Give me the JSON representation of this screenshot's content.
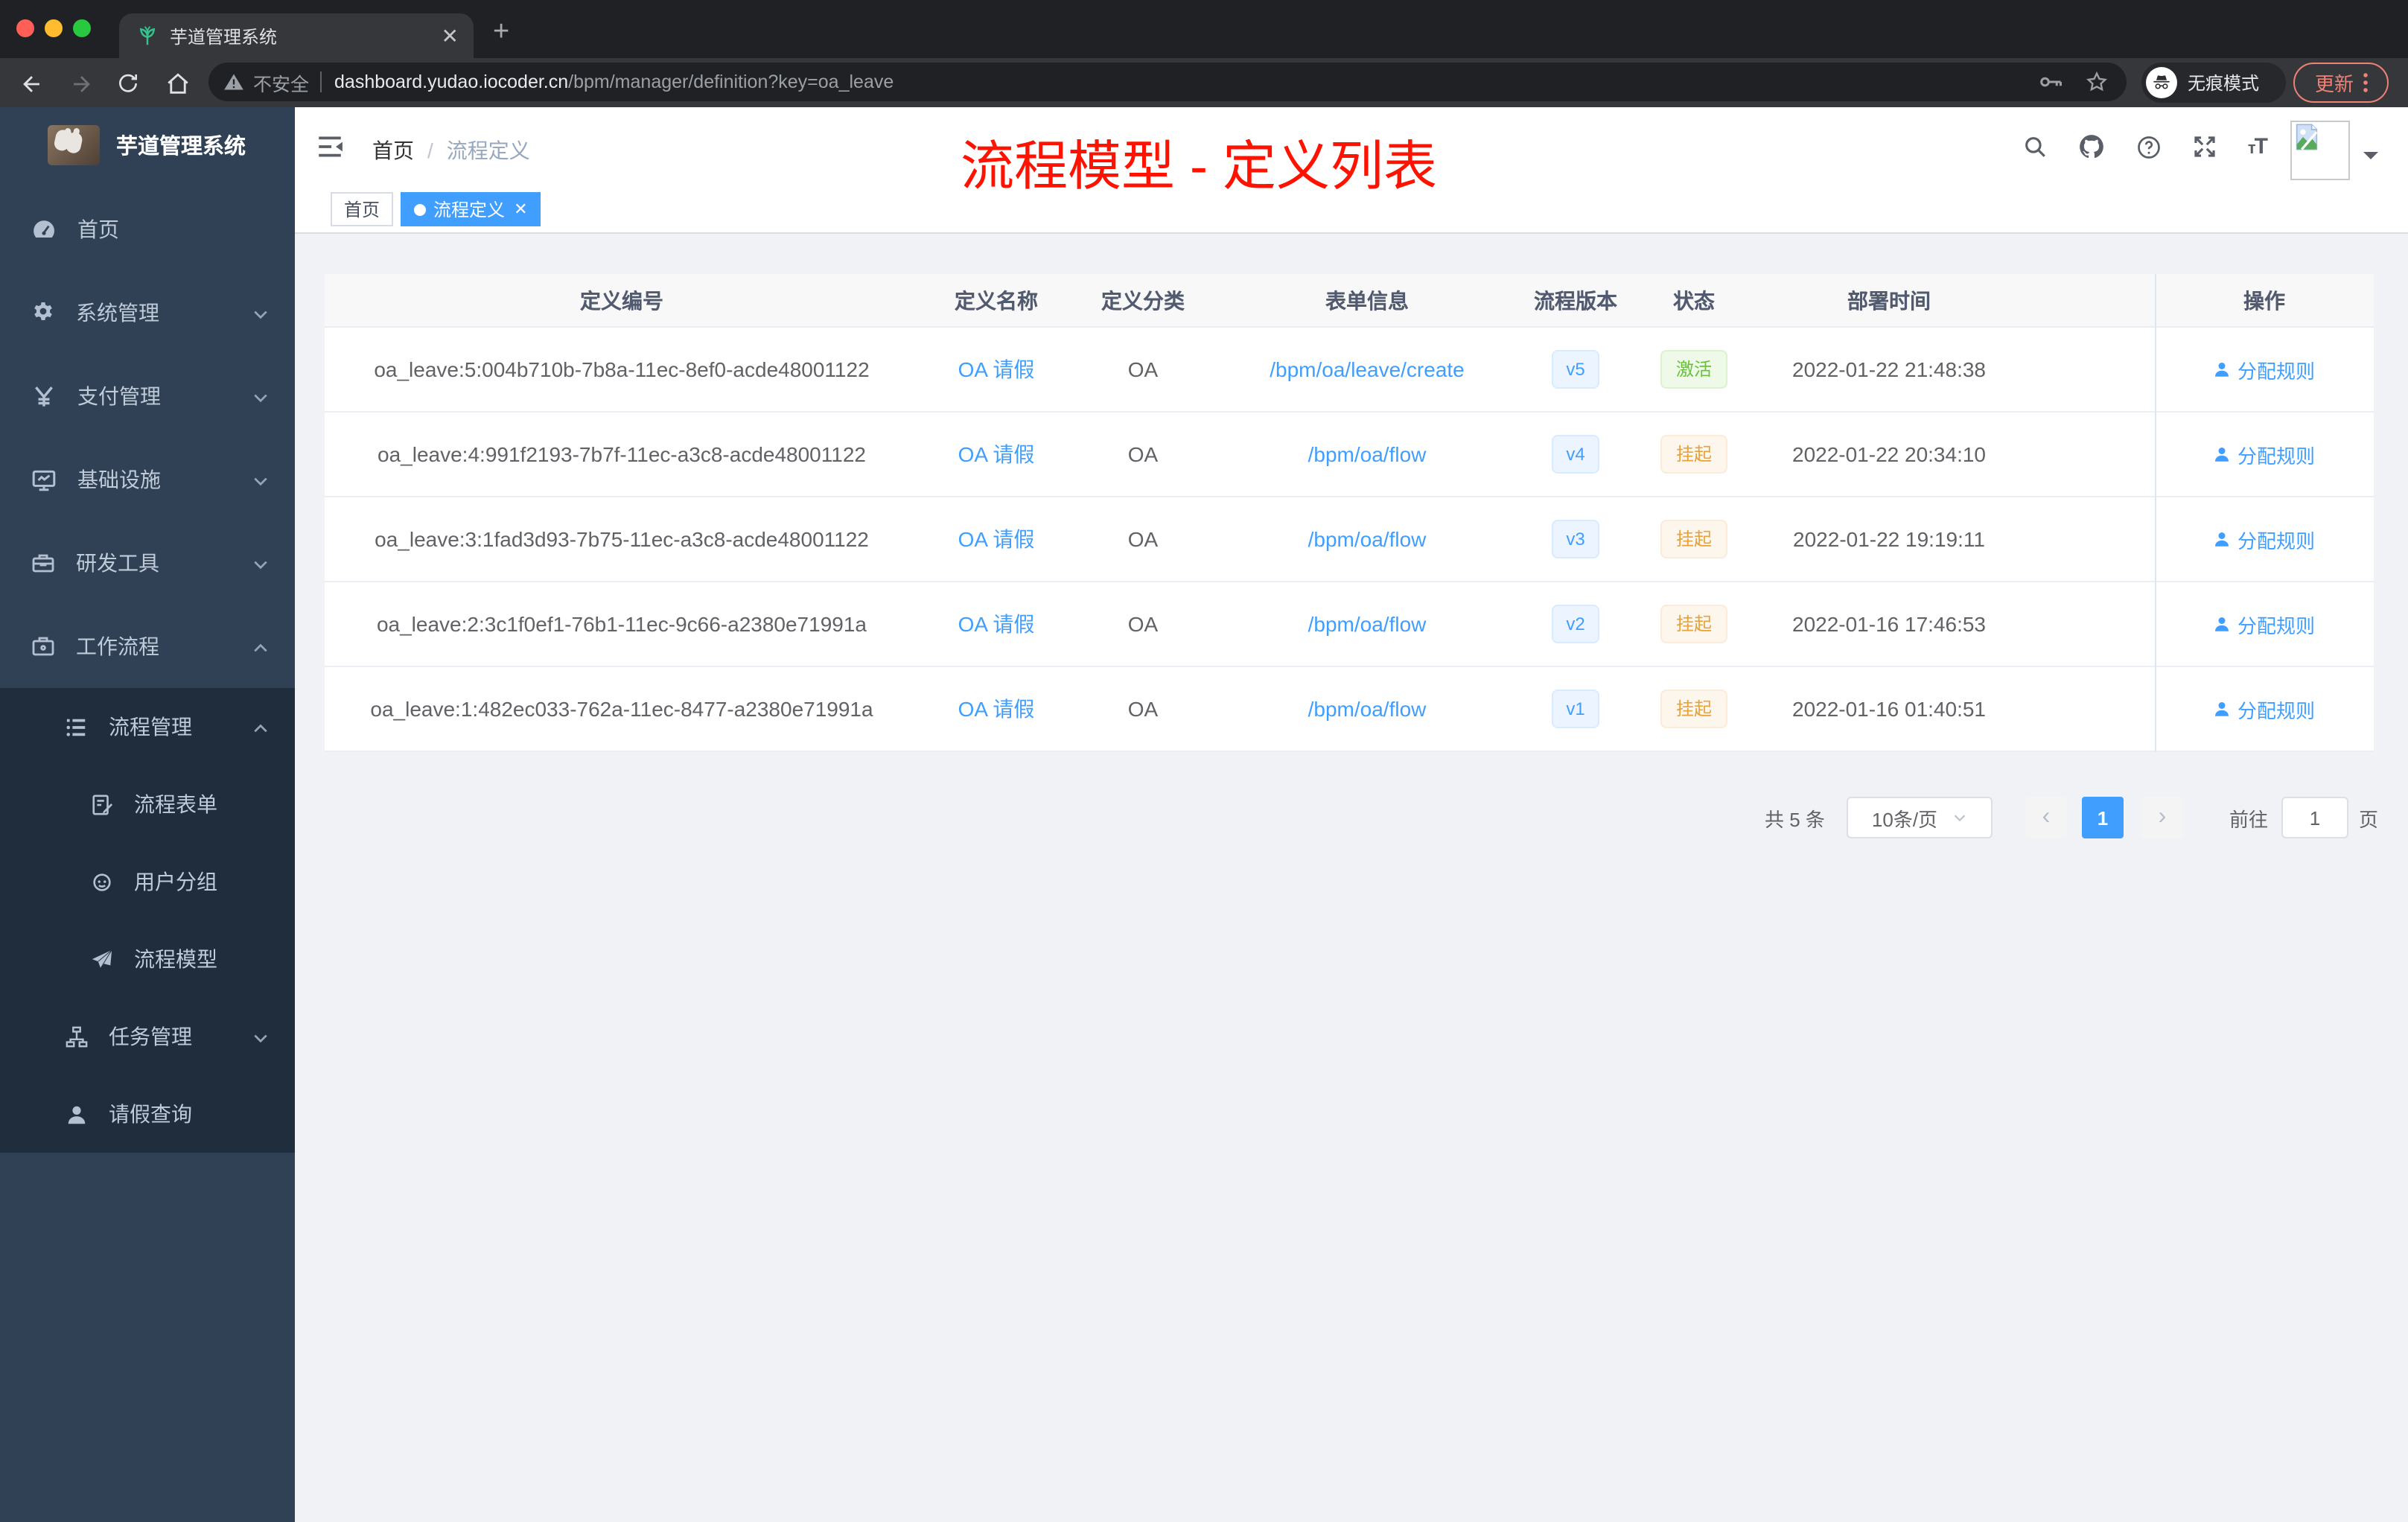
{
  "colors": {
    "accent": "#409eff",
    "success": "#67c23a",
    "warning": "#e6a23c",
    "annotation": "#ff1200",
    "sidebar_bg": "#304156",
    "submenu_bg": "#1f2d3d"
  },
  "browser": {
    "tab_title": "芋道管理系统",
    "new_tab": "+",
    "close_tab": "✕",
    "security_label": "不安全",
    "url_host": "dashboard.yudao.iocoder.cn",
    "url_path": "/bpm/manager/definition?key=oa_leave",
    "incognito_label": "无痕模式",
    "update_label": "更新"
  },
  "sidebar": {
    "logo_title": "芋道管理系统",
    "items": [
      {
        "label": "首页",
        "icon": "dashboard-icon"
      },
      {
        "label": "系统管理",
        "icon": "gear-icon"
      },
      {
        "label": "支付管理",
        "icon": "yen-icon"
      },
      {
        "label": "基础设施",
        "icon": "monitor-icon"
      },
      {
        "label": "研发工具",
        "icon": "toolbox-icon"
      },
      {
        "label": "工作流程",
        "icon": "briefcase-icon"
      },
      {
        "label": "流程管理",
        "icon": "list-tree-icon"
      },
      {
        "label": "流程表单",
        "icon": "form-icon"
      },
      {
        "label": "用户分组",
        "icon": "group-icon"
      },
      {
        "label": "流程模型",
        "icon": "paper-plane-icon"
      },
      {
        "label": "任务管理",
        "icon": "org-tree-icon"
      },
      {
        "label": "请假查询",
        "icon": "user-icon"
      }
    ]
  },
  "header": {
    "breadcrumb_home": "首页",
    "breadcrumb_sep": "/",
    "breadcrumb_current": "流程定义",
    "annotation": "流程模型 - 定义列表"
  },
  "tags": {
    "home": "首页",
    "current": "流程定义",
    "close": "✕"
  },
  "table": {
    "columns": [
      "定义编号",
      "定义名称",
      "定义分类",
      "表单信息",
      "流程版本",
      "状态",
      "部署时间",
      "操作"
    ],
    "rows": [
      {
        "id": "oa_leave:5:004b710b-7b8a-11ec-8ef0-acde48001122",
        "name": "OA 请假",
        "category": "OA",
        "form": "/bpm/oa/leave/create",
        "version": "v5",
        "status": "激活",
        "status_type": "active",
        "time": "2022-01-22 21:48:38",
        "action": "分配规则"
      },
      {
        "id": "oa_leave:4:991f2193-7b7f-11ec-a3c8-acde48001122",
        "name": "OA 请假",
        "category": "OA",
        "form": "/bpm/oa/flow",
        "version": "v4",
        "status": "挂起",
        "status_type": "suspended",
        "time": "2022-01-22 20:34:10",
        "action": "分配规则"
      },
      {
        "id": "oa_leave:3:1fad3d93-7b75-11ec-a3c8-acde48001122",
        "name": "OA 请假",
        "category": "OA",
        "form": "/bpm/oa/flow",
        "version": "v3",
        "status": "挂起",
        "status_type": "suspended",
        "time": "2022-01-22 19:19:11",
        "action": "分配规则"
      },
      {
        "id": "oa_leave:2:3c1f0ef1-76b1-11ec-9c66-a2380e71991a",
        "name": "OA 请假",
        "category": "OA",
        "form": "/bpm/oa/flow",
        "version": "v2",
        "status": "挂起",
        "status_type": "suspended",
        "time": "2022-01-16 17:46:53",
        "action": "分配规则"
      },
      {
        "id": "oa_leave:1:482ec033-762a-11ec-8477-a2380e71991a",
        "name": "OA 请假",
        "category": "OA",
        "form": "/bpm/oa/flow",
        "version": "v1",
        "status": "挂起",
        "status_type": "suspended",
        "time": "2022-01-16 01:40:51",
        "action": "分配规则"
      }
    ]
  },
  "pagination": {
    "total": "共 5 条",
    "page_size": "10条/页",
    "current_page": "1",
    "goto_label": "前往",
    "goto_value": "1",
    "page_label": "页"
  }
}
